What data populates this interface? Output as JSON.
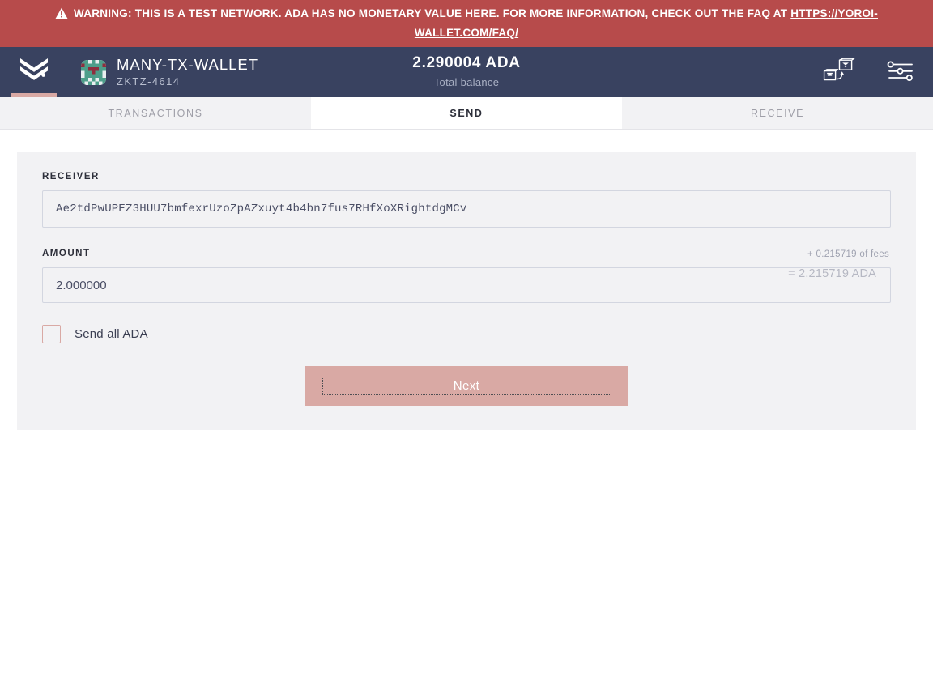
{
  "warning": {
    "icon": "warning-triangle-icon",
    "text_before": "WARNING: THIS IS A TEST NETWORK. ADA HAS NO MONETARY VALUE HERE. FOR MORE INFORMATION, CHECK OUT THE FAQ AT ",
    "link_text": "HTTPS://YOROI-WALLET.COM/FAQ/",
    "background_color": "#b74b4b"
  },
  "header": {
    "logo_icon": "yoroi-chevron-logo-icon",
    "accent_color": "#d9a9a4",
    "background_color": "#394260",
    "wallet": {
      "avatar_icon": "wallet-identicon-avatar",
      "name": "MANY-TX-WALLET",
      "plate_id": "ZKTZ-4614"
    },
    "balance": {
      "amount": "2.290004 ADA",
      "label": "Total balance"
    },
    "actions": [
      {
        "icon": "switch-wallet-icon",
        "name": "switch-wallet-button"
      },
      {
        "icon": "settings-sliders-icon",
        "name": "settings-button"
      }
    ]
  },
  "tabs": [
    {
      "label": "Transactions",
      "name": "tab-transactions",
      "active": false
    },
    {
      "label": "Send",
      "name": "tab-send",
      "active": true
    },
    {
      "label": "Receive",
      "name": "tab-receive",
      "active": false
    }
  ],
  "send_form": {
    "receiver": {
      "label": "Receiver",
      "value": "Ae2tdPwUPEZ3HUU7bmfexrUzoZpAZxuyt4b4bn7fus7RHfXoXRightdgMCv",
      "placeholder": ""
    },
    "amount": {
      "label": "Amount",
      "value": "2.000000",
      "placeholder": "",
      "fee_note": "+ 0.215719 of fees",
      "total": "= 2.215719 ADA"
    },
    "send_all": {
      "label": "Send all ADA",
      "checked": false
    },
    "next_button": {
      "label": "Next",
      "color": "#d9a9a4"
    }
  }
}
